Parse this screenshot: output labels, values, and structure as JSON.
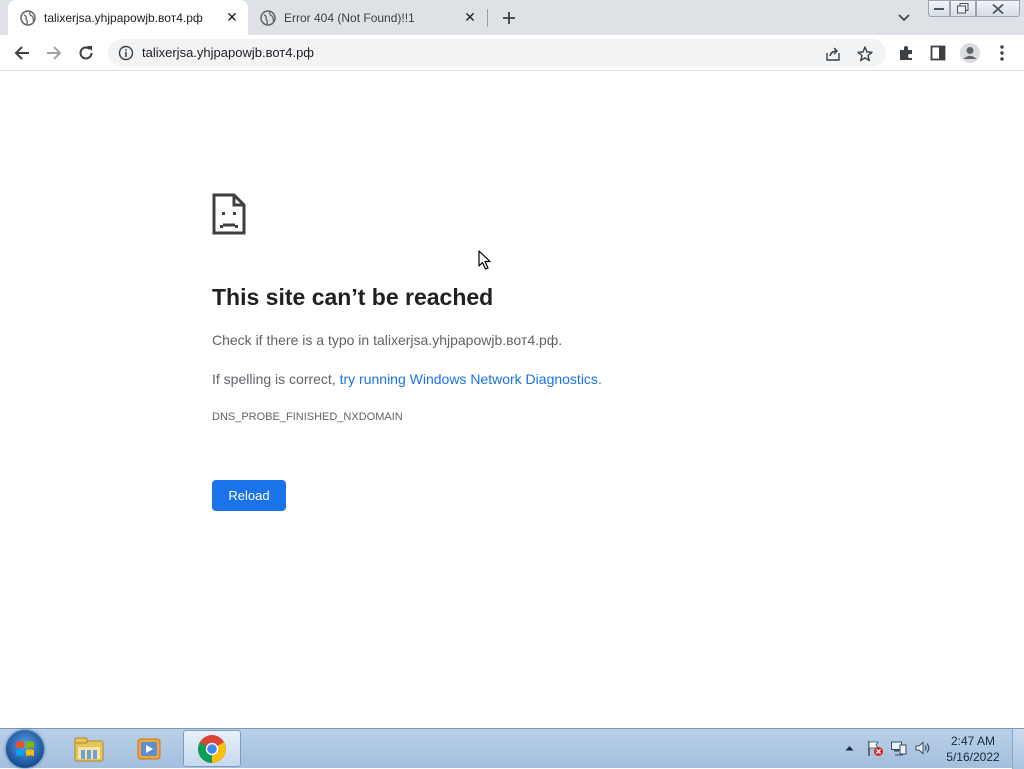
{
  "tabs": [
    {
      "title": "talixerjsa.yhjpapowjb.вот4.рф",
      "active": true,
      "favicon": "globe-icon"
    },
    {
      "title": "Error 404 (Not Found)!!1",
      "active": false,
      "favicon": "globe-icon"
    }
  ],
  "toolbar": {
    "url": "talixerjsa.yhjpapowjb.вот4.рф"
  },
  "error": {
    "title": "This site can’t be reached",
    "line1": "Check if there is a typo in talixerjsa.yhjpapowjb.вот4.рф.",
    "line2_prefix": "If spelling is correct, ",
    "line2_link": "try running Windows Network Diagnostics",
    "line2_suffix": ".",
    "code": "DNS_PROBE_FINISHED_NXDOMAIN",
    "reload_label": "Reload"
  },
  "taskbar": {
    "apps": [
      "windows-explorer",
      "media-player",
      "google-chrome"
    ],
    "clock_time": "2:47 AM",
    "clock_date": "5/16/2022"
  },
  "colors": {
    "accent": "#1a73e8",
    "tabstrip": "#dee1e6",
    "text_secondary": "#5f6368"
  }
}
